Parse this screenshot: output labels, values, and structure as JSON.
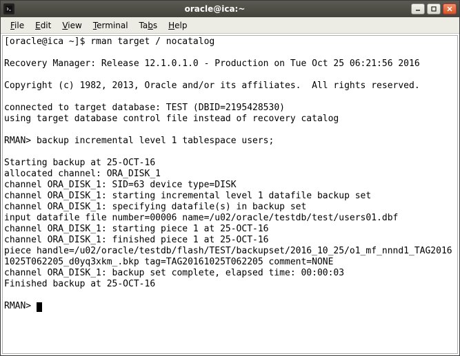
{
  "window": {
    "title": "oracle@ica:~"
  },
  "menubar": {
    "file": {
      "label": "File",
      "accel": "F"
    },
    "edit": {
      "label": "Edit",
      "accel": "E"
    },
    "view": {
      "label": "View",
      "accel": "V"
    },
    "terminal": {
      "label": "Terminal",
      "accel": "T"
    },
    "tabs": {
      "label": "Tabs",
      "accel": "b"
    },
    "help": {
      "label": "Help",
      "accel": "H"
    }
  },
  "terminal": {
    "lines": [
      "[oracle@ica ~]$ rman target / nocatalog",
      "",
      "Recovery Manager: Release 12.1.0.1.0 - Production on Tue Oct 25 06:21:56 2016",
      "",
      "Copyright (c) 1982, 2013, Oracle and/or its affiliates.  All rights reserved.",
      "",
      "connected to target database: TEST (DBID=2195428530)",
      "using target database control file instead of recovery catalog",
      "",
      "RMAN> backup incremental level 1 tablespace users;",
      "",
      "Starting backup at 25-OCT-16",
      "allocated channel: ORA_DISK_1",
      "channel ORA_DISK_1: SID=63 device type=DISK",
      "channel ORA_DISK_1: starting incremental level 1 datafile backup set",
      "channel ORA_DISK_1: specifying datafile(s) in backup set",
      "input datafile file number=00006 name=/u02/oracle/testdb/test/users01.dbf",
      "channel ORA_DISK_1: starting piece 1 at 25-OCT-16",
      "channel ORA_DISK_1: finished piece 1 at 25-OCT-16",
      "piece handle=/u02/oracle/testdb/flash/TEST/backupset/2016_10_25/o1_mf_nnnd1_TAG20161025T062205_d0yq3xkm_.bkp tag=TAG20161025T062205 comment=NONE",
      "channel ORA_DISK_1: backup set complete, elapsed time: 00:00:03",
      "Finished backup at 25-OCT-16",
      "",
      "RMAN> "
    ]
  }
}
